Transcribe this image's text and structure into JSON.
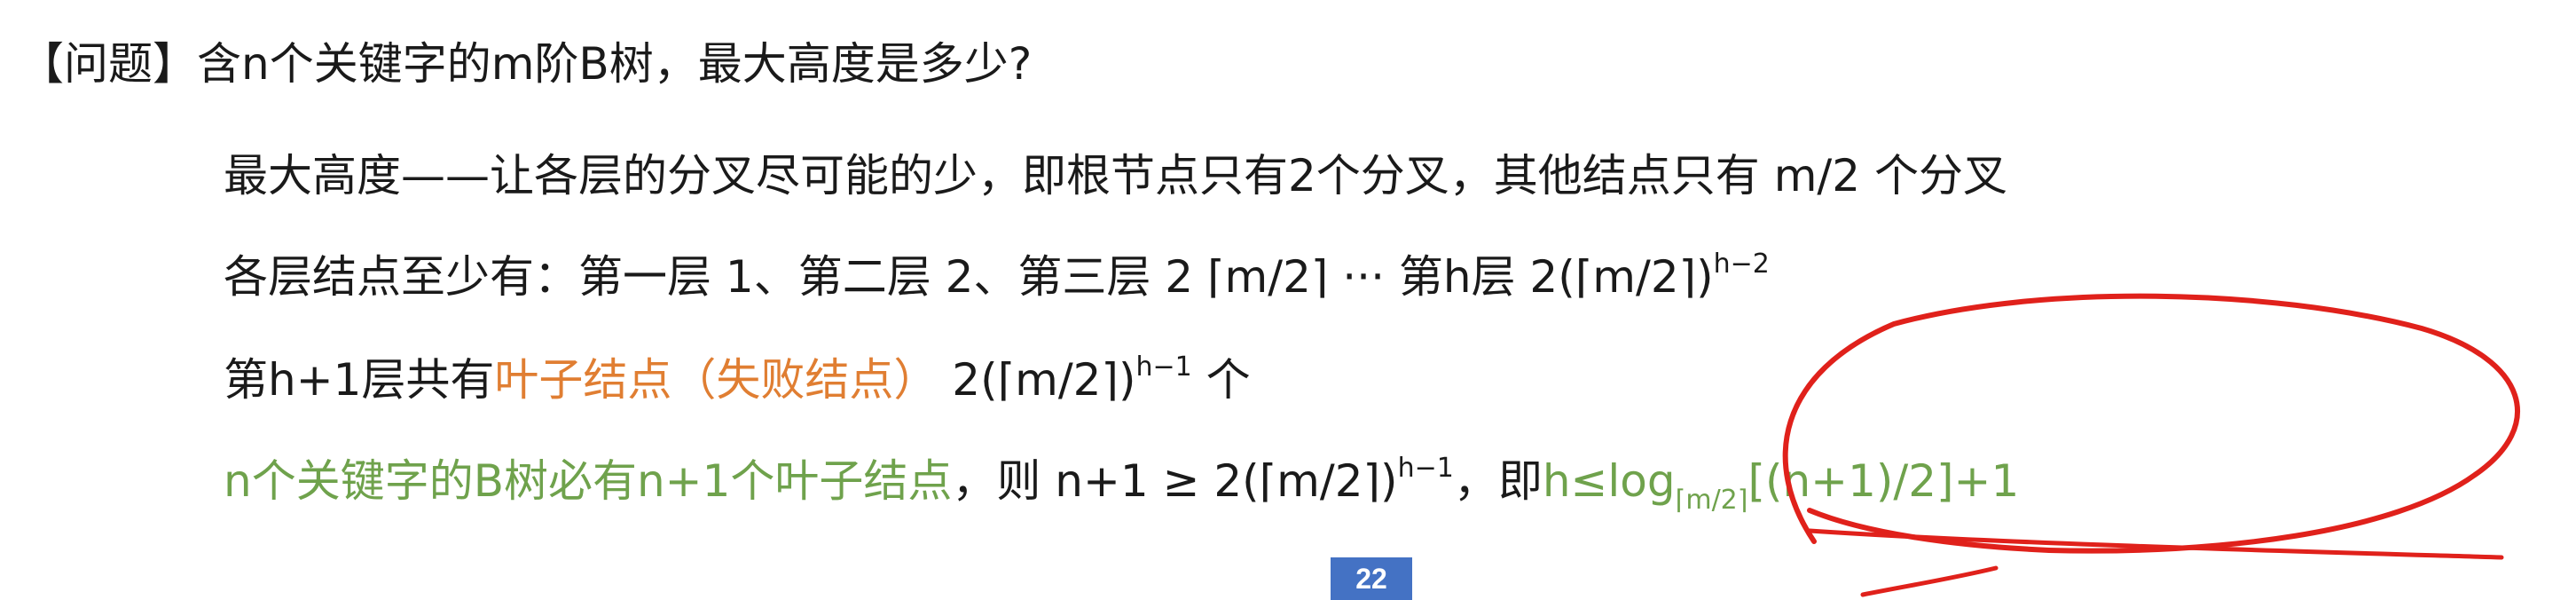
{
  "line1": {
    "bracket": "【问题】",
    "text": "含n个关键字的m阶B树，最大高度是多少?"
  },
  "line2": {
    "text": "最大高度——让各层的分叉尽可能的少，即根节点只有2个分叉，其他结点只有 m/2 个分叉"
  },
  "line3": {
    "text": "各层结点至少有：第一层 1、第二层 2、第三层 2 ⌈m/2⌉ ··· 第h层 2(⌈m/2⌉)",
    "exp": "h−2"
  },
  "line4": {
    "pre": "第h+1层共有",
    "highlight": "叶子结点（失败结点）",
    "mid": " 2(⌈m/2⌉)",
    "exp": "h−1",
    "post": " 个"
  },
  "line5": {
    "green1": "n个关键字的B树必有n+1个叶子结点",
    "black1": "，则 n+1 ≥ 2(⌈m/2⌉)",
    "exp": "h−1",
    "black2": "，即",
    "green2a": "h≤log",
    "sub": "⌈m/2⌉",
    "green2b": "[(n+1)/2]+1"
  },
  "page_number": "22",
  "colors": {
    "orange": "#e07e32",
    "green": "#6fa24c",
    "ink": "#e0211b",
    "page_badge": "#4472c4"
  }
}
